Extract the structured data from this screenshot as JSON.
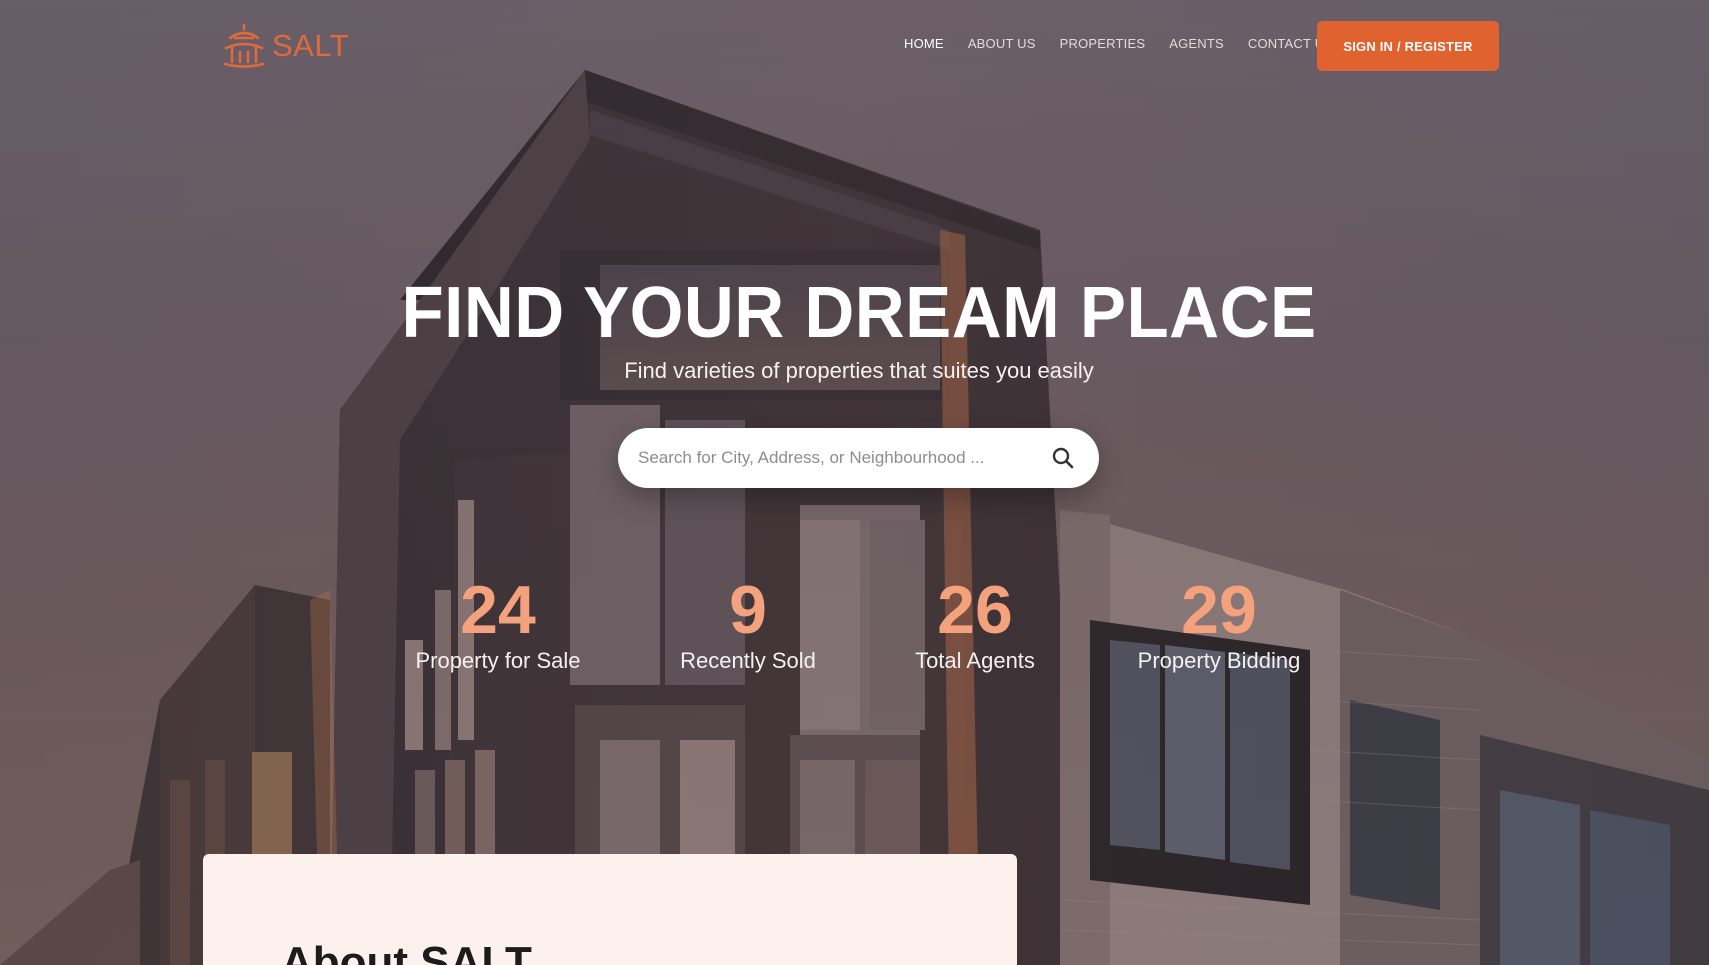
{
  "brand": {
    "name": "SALT",
    "logo_icon": "pagoda-icon",
    "accent_color": "#e0622f"
  },
  "nav": {
    "items": [
      {
        "label": "HOME",
        "active": true
      },
      {
        "label": "ABOUT US",
        "active": false
      },
      {
        "label": "PROPERTIES",
        "active": false
      },
      {
        "label": "AGENTS",
        "active": false
      },
      {
        "label": "CONTACT US",
        "active": false
      }
    ],
    "signin_label": "SIGN IN / REGISTER"
  },
  "hero": {
    "title": "FIND YOUR DREAM PLACE",
    "subtitle": "Find varieties of properties that suites you easily",
    "search": {
      "placeholder": "Search for City, Address, or Neighbourhood ...",
      "value": "",
      "icon": "search-icon"
    }
  },
  "stats": [
    {
      "value": "24",
      "label": "Property for Sale"
    },
    {
      "value": "9",
      "label": "Recently Sold"
    },
    {
      "value": "26",
      "label": "Total Agents"
    },
    {
      "value": "29",
      "label": "Property Bidding"
    }
  ],
  "about": {
    "title": "About SALT"
  },
  "colors": {
    "stat_number": "#f3a27d",
    "card_background": "#fdf1ee"
  }
}
